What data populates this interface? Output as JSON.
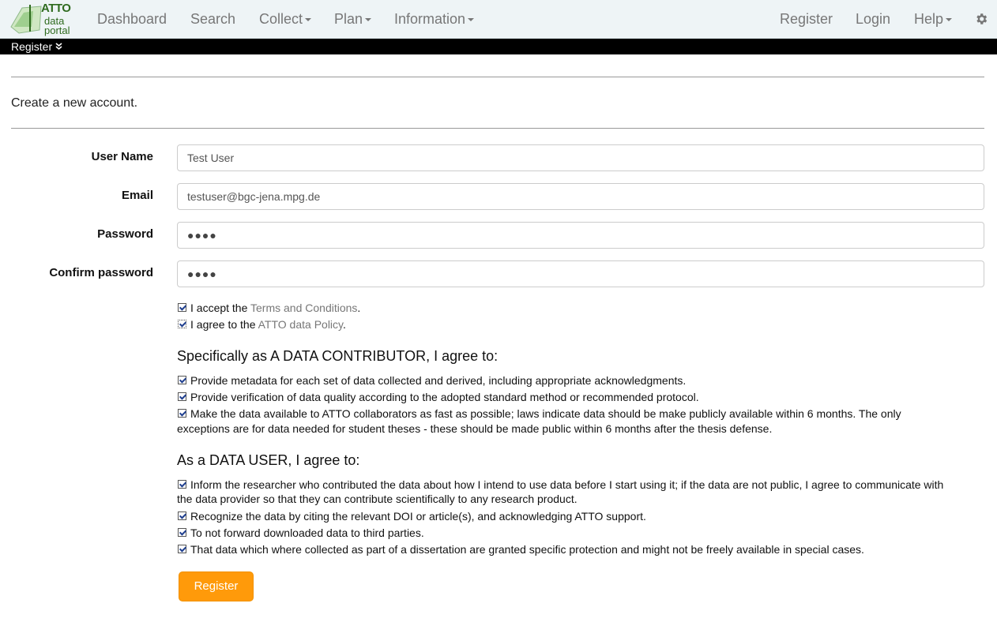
{
  "navbar": {
    "logo": {
      "title": "ATTO",
      "line1": "data",
      "line2": "portal"
    },
    "left_items": [
      {
        "label": "Dashboard"
      },
      {
        "label": "Search"
      },
      {
        "label": "Collect"
      },
      {
        "label": "Plan"
      },
      {
        "label": "Information"
      }
    ],
    "right_items": [
      {
        "label": "Register"
      },
      {
        "label": "Login"
      },
      {
        "label": "Help"
      }
    ],
    "settings_icon": "gear-icon"
  },
  "subbar": {
    "label": "Register",
    "icon": "double-chevron-down-icon"
  },
  "page": {
    "intro": "Create a new account."
  },
  "form": {
    "user_name": {
      "label": "User Name",
      "value": "Test User"
    },
    "email": {
      "label": "Email",
      "value": "testuser@bgc-jena.mpg.de"
    },
    "password": {
      "label": "Password",
      "value": "●●●●"
    },
    "confirm_password": {
      "label": "Confirm password",
      "value": "●●●●"
    },
    "accept_terms": {
      "prefix": "I accept the ",
      "link": "Terms and Conditions",
      "suffix": "."
    },
    "agree_policy": {
      "prefix": "I agree to the ",
      "link": "ATTO data Policy",
      "suffix": "."
    },
    "contributor_heading": "Specifically as A DATA CONTRIBUTOR, I agree to:",
    "contributor_items": [
      "Provide metadata for each set of data collected and derived, including appropriate acknowledgments.",
      "Provide verification of data quality according to the adopted standard method or recommended protocol.",
      "Make the data available to ATTO collaborators as fast as possible; laws indicate data should be make publicly available within 6 months. The only",
      "exceptions are for data needed for student theses - these should be made public within 6 months after the thesis defense."
    ],
    "user_heading": "As a DATA USER, I agree to:",
    "user_items": [
      "Inform the researcher who contributed the data about how I intend to use data before I start using it; if the data are not public, I agree to communicate with",
      "the data provider so that they can contribute scientifically to any research product.",
      "Recognize the data by citing the relevant DOI or article(s), and acknowledging ATTO support.",
      "To not forward downloaded data to third parties.",
      "That data which where collected as part of a dissertation are granted specific protection and might not be freely available in special cases."
    ],
    "submit_label": "Register"
  }
}
